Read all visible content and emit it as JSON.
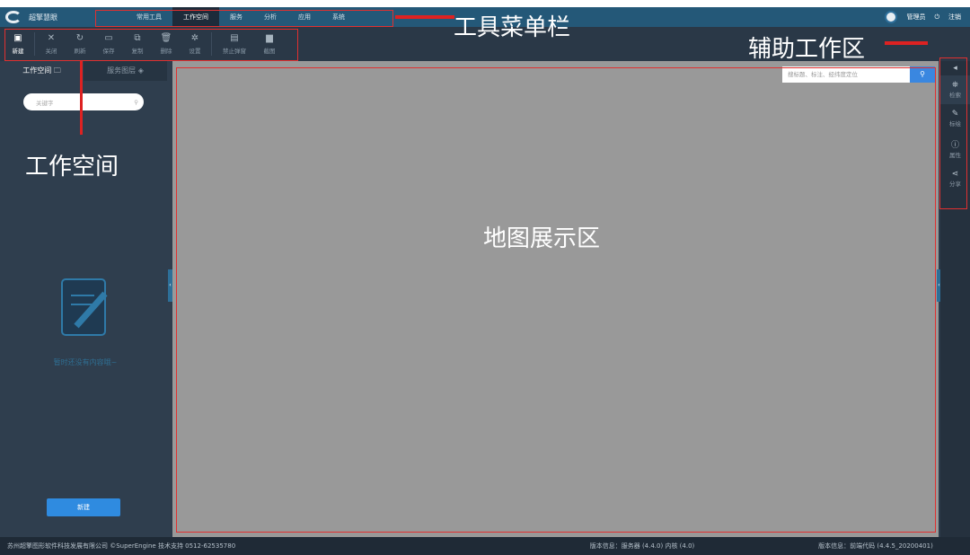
{
  "app": {
    "name": "超擎慧眼"
  },
  "menu": [
    {
      "label": "常用工具"
    },
    {
      "label": "工作空间",
      "active": true
    },
    {
      "label": "服务"
    },
    {
      "label": "分析"
    },
    {
      "label": "应用"
    },
    {
      "label": "系统"
    }
  ],
  "user": {
    "name": "管理员",
    "logout": "注销"
  },
  "toolbar": [
    {
      "label": "新建",
      "icon": "new-icon"
    },
    {
      "label": "关闭",
      "icon": "close-icon"
    },
    {
      "label": "刷新",
      "icon": "refresh-icon"
    },
    {
      "label": "保存",
      "icon": "save-icon"
    },
    {
      "label": "复制",
      "icon": "copy-icon"
    },
    {
      "label": "删除",
      "icon": "delete-icon"
    },
    {
      "label": "设置",
      "icon": "gear-icon"
    },
    {
      "label": "禁止弹窗",
      "icon": "popup-icon"
    },
    {
      "label": "截图",
      "icon": "screenshot-icon"
    }
  ],
  "left": {
    "tabs": [
      {
        "label": "工作空间"
      },
      {
        "label": "服务图层"
      }
    ],
    "search_placeholder": "关键字",
    "empty_text": "暂时还没有内容哦~",
    "new_button": "新建"
  },
  "map": {
    "search_placeholder": "搜标题、标注、经纬度定位"
  },
  "right_panel": {
    "items": [
      {
        "label": "检索"
      },
      {
        "label": "标绘"
      },
      {
        "label": "属性"
      },
      {
        "label": "分享"
      }
    ]
  },
  "footer": {
    "copyright": "苏州超擎图形软件科技发展有限公司 ©SuperEngine 技术支持 0512-62535780",
    "server_version": "版本信息：服务器 (4.4.0)  内核 (4.0)",
    "client_version": "版本信息：前端代码 (4.4.5_20200401)"
  },
  "annotations": {
    "toolbar_label": "工具菜单栏",
    "assist_label": "辅助工作区",
    "workspace_label": "工作空间",
    "map_label": "地图展示区"
  },
  "colors": {
    "accent": "#2f8be0",
    "annotation": "#e03030"
  }
}
